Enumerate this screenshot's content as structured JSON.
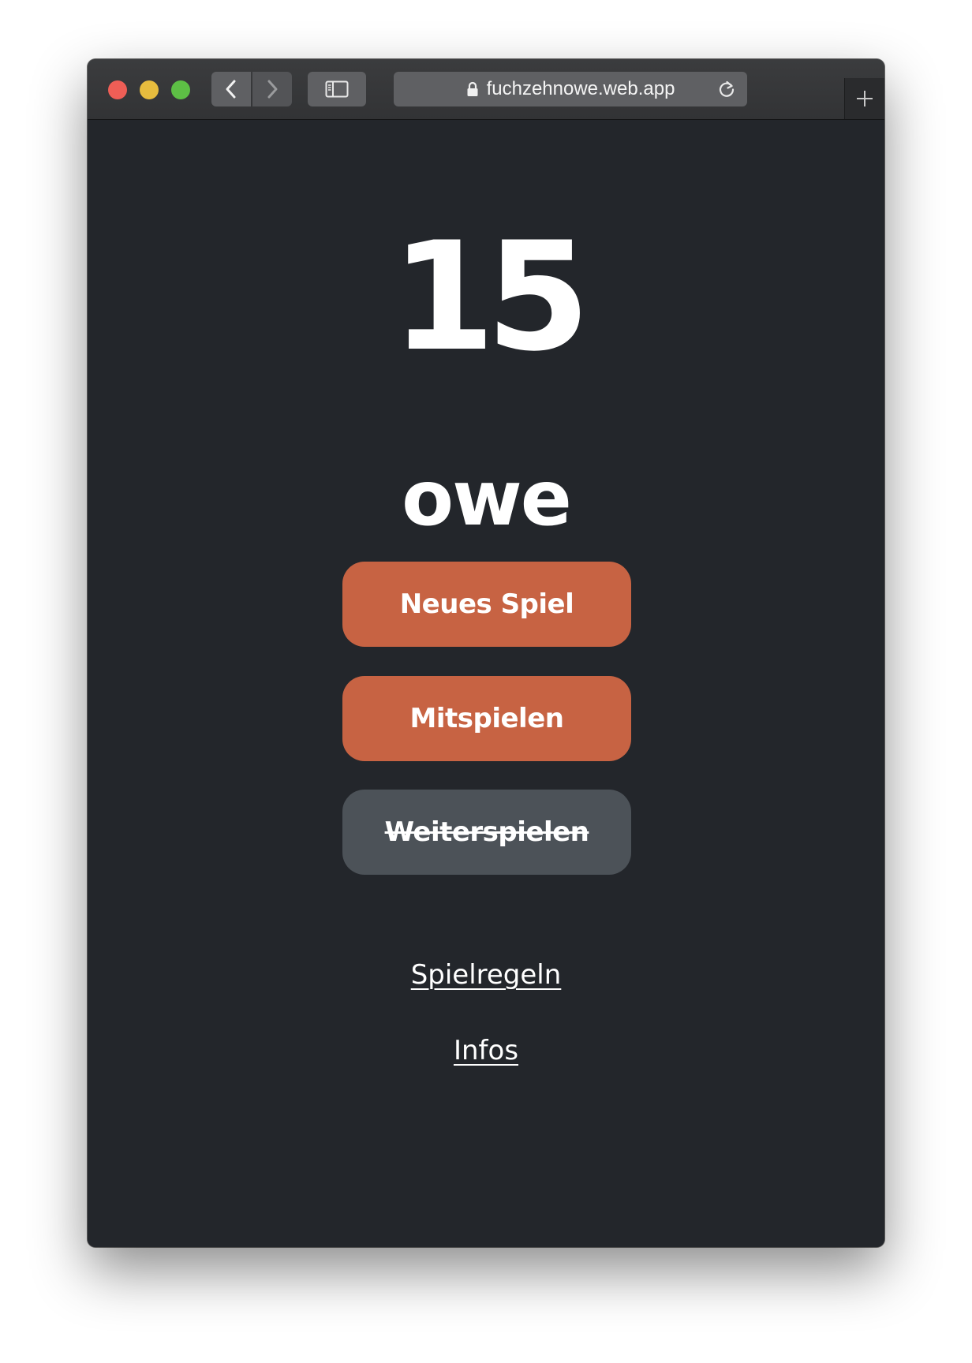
{
  "browser": {
    "url": "fuchzehnowe.web.app",
    "icons": {
      "back": "chevron-left-icon",
      "forward": "chevron-right-icon",
      "sidebar": "sidebar-icon",
      "lock": "lock-icon",
      "reload": "reload-icon",
      "new_tab": "plus-icon"
    },
    "traffic_lights": {
      "close": "#ee5e56",
      "minimize": "#e7bc3e",
      "maximize": "#5dbf45"
    }
  },
  "app": {
    "logo_number": "15",
    "logo_word": "owe",
    "buttons": {
      "new_game": "Neues Spiel",
      "join": "Mitspielen",
      "continue": "Weiterspielen"
    },
    "continue_disabled": true,
    "links": {
      "rules": "Spielregeln",
      "infos": "Infos"
    }
  },
  "colors": {
    "background": "#23262b",
    "primary_button": "#c76343",
    "disabled_button": "#4c5258",
    "text": "#ffffff"
  }
}
